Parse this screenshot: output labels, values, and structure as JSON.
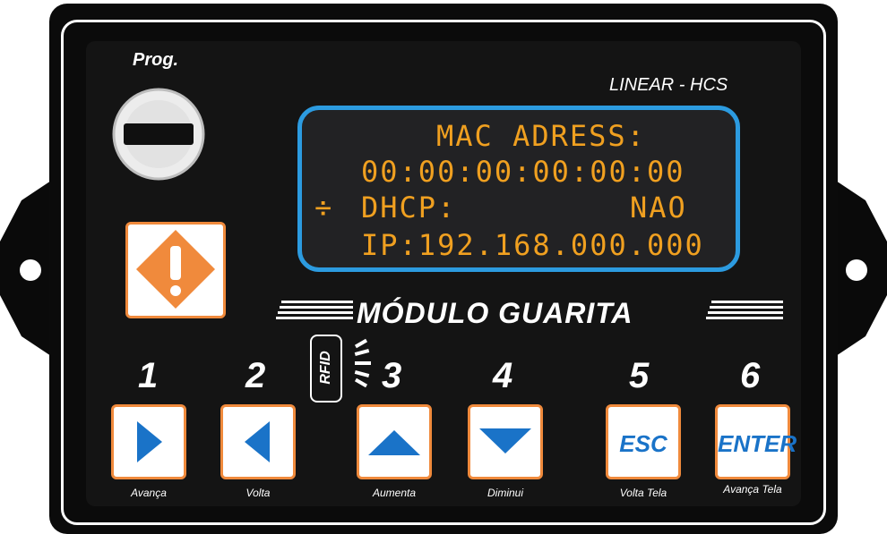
{
  "device": {
    "prog_label": "Prog.",
    "brand": "LINEAR - HCS",
    "title": "MÓDULO GUARITA",
    "rfid_label": "RFID"
  },
  "lcd": {
    "line1": "MAC ADRESS:",
    "line2": "00:00:00:00:00:00",
    "line3_label": "DHCP:",
    "line3_value": "NAO",
    "line4": "IP:192.168.000.000",
    "cursor": "÷"
  },
  "buttons": [
    {
      "number": "1",
      "caption": "Avança"
    },
    {
      "number": "2",
      "caption": "Volta"
    },
    {
      "number": "3",
      "caption": "Aumenta"
    },
    {
      "number": "4",
      "caption": "Diminui"
    },
    {
      "number": "5",
      "caption": "Volta Tela",
      "text": "ESC"
    },
    {
      "number": "6",
      "caption": "Avança Tela",
      "text": "ENTER"
    }
  ],
  "colors": {
    "accent_blue": "#2c9be0",
    "accent_orange": "#f08a3c",
    "lcd_text": "#f0a020"
  },
  "icons": [
    "key-switch-icon",
    "warning-diamond-icon",
    "arrow-right-icon",
    "arrow-left-icon",
    "arrow-up-icon",
    "arrow-down-icon",
    "rfid-icon"
  ]
}
